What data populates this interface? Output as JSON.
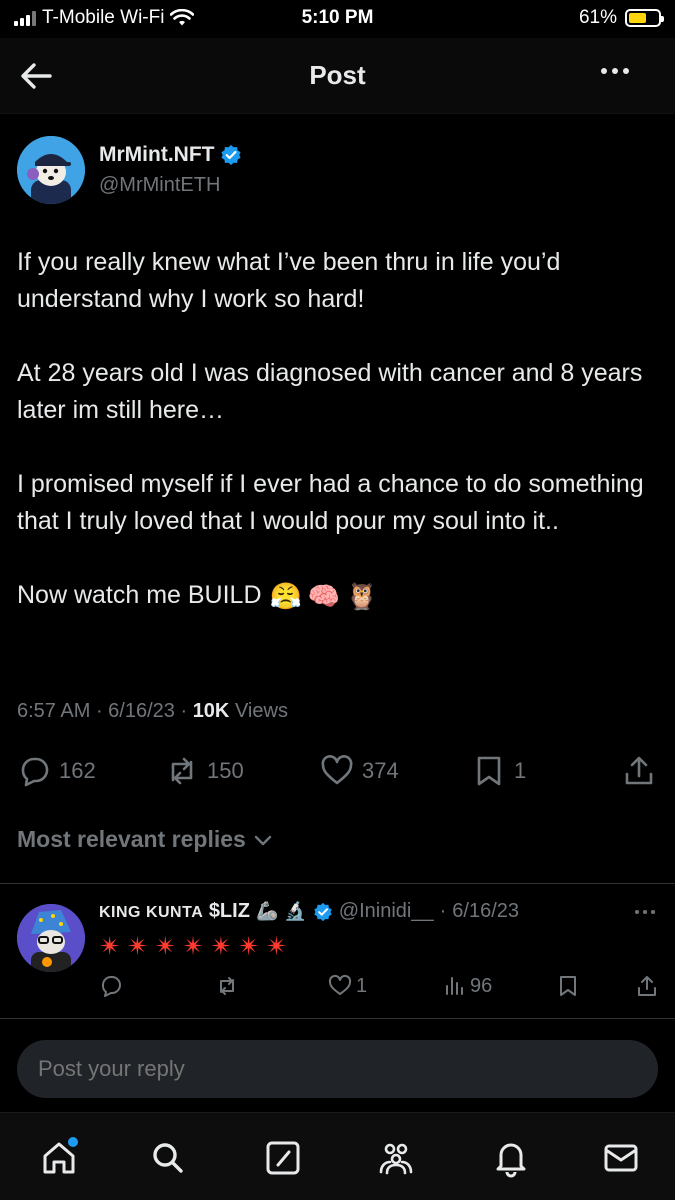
{
  "status_bar": {
    "carrier": "T-Mobile Wi-Fi",
    "time": "5:10 PM",
    "battery": "61%",
    "battery_level": 0.61
  },
  "header": {
    "title": "Post",
    "back_icon": "arrow-left-icon",
    "more_icon": "more-horizontal-icon"
  },
  "post": {
    "author_name": "MrMint.NFT",
    "author_handle": "@MrMintETH",
    "verified": true,
    "text": "If you really knew what I’ve been thru in life you’d understand why I work so hard!\n\nAt 28 years old I was diagnosed with cancer and 8 years later im still here…\n\nI promised myself if I ever had a chance to do something that I truly loved that I would pour my soul into it..\n\nNow watch me BUILD",
    "emojis": [
      "😤",
      "🧠",
      "🦉"
    ],
    "time": "6:57 AM",
    "date": "6/16/23",
    "views_count": "10K",
    "views_label": "Views",
    "stats": {
      "replies": "162",
      "reposts": "150",
      "likes": "374",
      "bookmarks": "1"
    }
  },
  "replies_section": {
    "label": "Most relevant replies"
  },
  "reply": {
    "name_prefix": "King Kunta",
    "name_suffix": "$LIZ",
    "name_emojis": [
      "🦾",
      "🔬"
    ],
    "verified": true,
    "handle": "@Ininidi__",
    "date": "6/16/23",
    "sparkle_count": 7,
    "stats": {
      "replies": "",
      "reposts": "",
      "likes": "1",
      "views": "96"
    }
  },
  "composer": {
    "placeholder": "Post your reply"
  },
  "nav": {
    "items": [
      "home-icon",
      "search-icon",
      "compose-icon",
      "communities-icon",
      "notifications-icon",
      "messages-icon"
    ]
  },
  "colors": {
    "accent": "#1d9bf0",
    "background": "#000000",
    "muted": "#71767b",
    "text": "#e7e9ea",
    "battery": "#ffd60a"
  }
}
